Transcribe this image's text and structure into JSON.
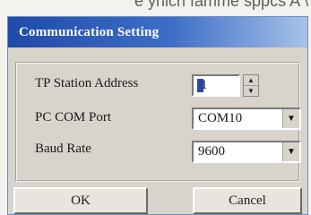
{
  "background_fragment": "e yhich famme sppcs A   \\",
  "dialog": {
    "title": "Communication Setting",
    "titlebar_color_start": "#1f4aa8",
    "titlebar_color_end": "#a8c2ea",
    "fields": {
      "tp_station_address": {
        "label": "TP Station Address",
        "value": "1",
        "spin_up_icon": "spin-up-arrow",
        "spin_down_icon": "spin-down-arrow"
      },
      "pc_com_port": {
        "label": "PC COM Port",
        "value": "COM10",
        "dropdown_icon": "chevron-down"
      },
      "baud_rate": {
        "label": "Baud Rate",
        "value": "9600",
        "dropdown_icon": "chevron-down"
      }
    },
    "buttons": {
      "ok": "OK",
      "cancel": "Cancel"
    }
  }
}
